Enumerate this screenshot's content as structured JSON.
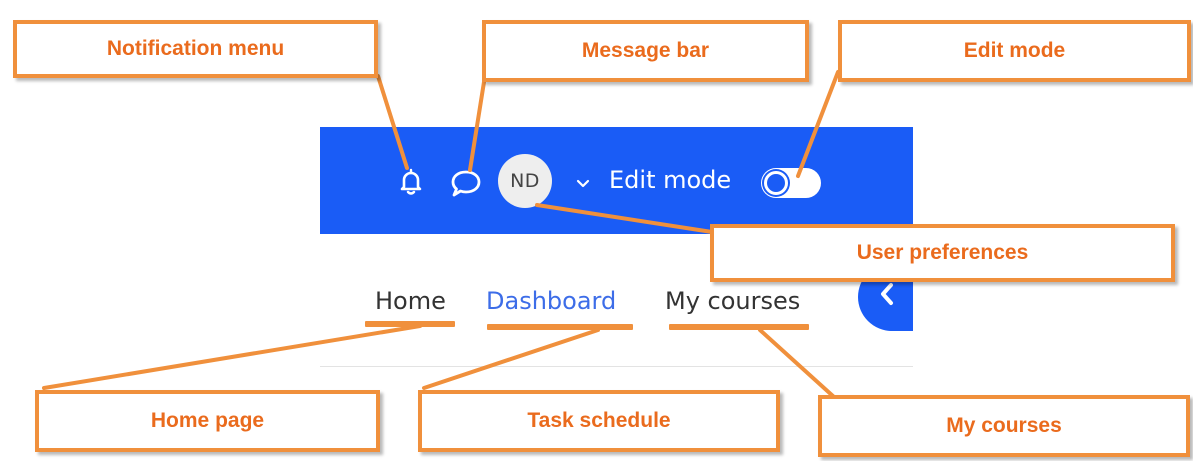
{
  "navbar": {
    "icons": [
      "bell-icon",
      "chat-bubble-icon",
      "chevron-down-icon"
    ],
    "avatar_initials": "ND",
    "edit_mode_label": "Edit mode",
    "edit_mode_on": false
  },
  "subnav": {
    "home": "Home",
    "dashboard": "Dashboard",
    "my_courses": "My courses",
    "drawer_icon": "chevron-left-icon"
  },
  "callouts": {
    "notification_menu": "Notification menu",
    "message_bar": "Message bar",
    "edit_mode": "Edit mode",
    "user_preferences": "User preferences",
    "home_page": "Home page",
    "task_schedule": "Task schedule",
    "my_courses": "My courses"
  },
  "colors": {
    "navbar_blue": "#1a5cf6",
    "dashboard_link": "#3d6de8",
    "callout_orange": "#f0903c",
    "callout_text": "#ea6b1d"
  }
}
